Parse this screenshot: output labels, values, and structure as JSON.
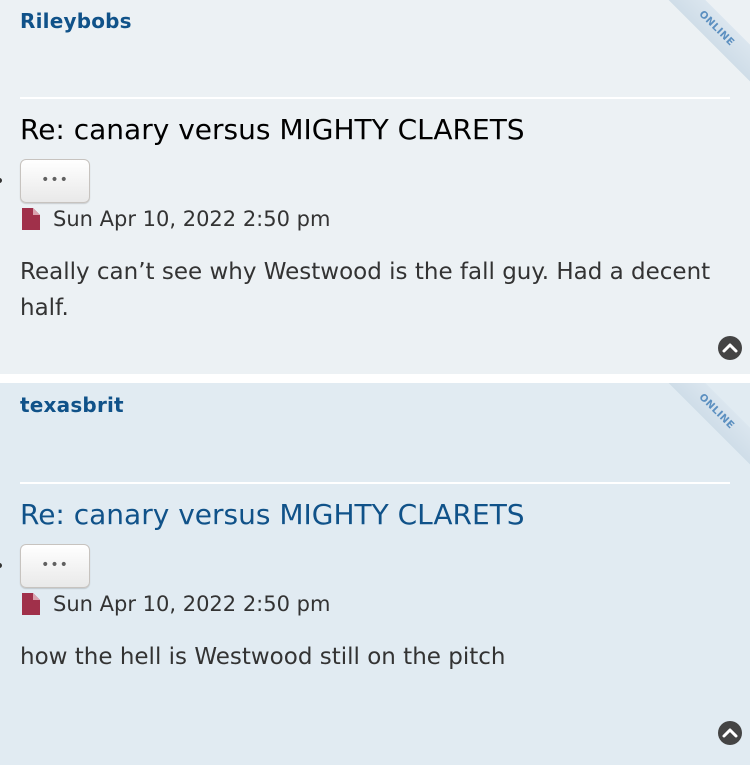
{
  "posts": [
    {
      "author": "Rileybobs",
      "status": "ONLINE",
      "title": "Re: canary versus MIGHTY CLARETS",
      "more_button": "•••",
      "date": "Sun Apr 10, 2022 2:50 pm",
      "content": "Really can’t see why Westwood is the fall guy. Had a decent half."
    },
    {
      "author": "texasbrit",
      "status": "ONLINE",
      "title": "Re: canary versus MIGHTY CLARETS",
      "more_button": "•••",
      "date": "Sun Apr 10, 2022 2:50 pm",
      "content": "how the hell is Westwood still on the pitch"
    }
  ],
  "colors": {
    "post_bg_1": "#ecf1f4",
    "post_bg_2": "#e1ebf2",
    "author": "#105289",
    "post_icon": "#a0304a",
    "back_to_top": "#444444"
  },
  "icons": {
    "post": "post-document-icon",
    "back_to_top": "chevron-up-circle-icon",
    "more": "ellipsis-icon"
  }
}
